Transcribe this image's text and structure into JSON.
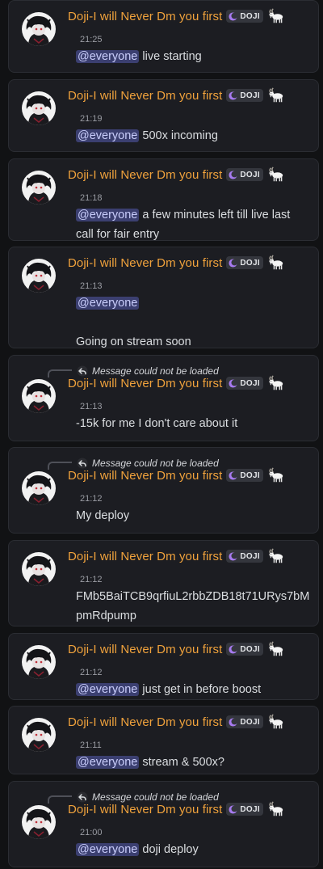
{
  "messages": [
    {
      "username": "Doji-I will Never Dm you first",
      "tag": "DOJI",
      "time": "21:25",
      "reply": null,
      "content": [
        {
          "mention": "@everyone",
          "text": " live starting"
        }
      ]
    },
    {
      "username": "Doji-I will Never Dm you first",
      "tag": "DOJI",
      "time": "21:19",
      "reply": null,
      "content": [
        {
          "mention": "@everyone",
          "text": " 500x incoming"
        }
      ]
    },
    {
      "username": "Doji-I will Never Dm you first",
      "tag": "DOJI",
      "time": "21:18",
      "reply": null,
      "content": [
        {
          "mention": "@everyone",
          "text": " a few minutes left till live last"
        },
        {
          "text": "call for fair entry"
        }
      ]
    },
    {
      "username": "Doji-I will Never Dm you first",
      "tag": "DOJI",
      "time": "21:13",
      "reply": null,
      "content": [
        {
          "mention": "@everyone"
        },
        {
          "text": ""
        },
        {
          "text": "Going on stream soon"
        }
      ]
    },
    {
      "username": "Doji-I will Never Dm you first",
      "tag": "DOJI",
      "time": "21:13",
      "reply": "Message could not be loaded",
      "content": [
        {
          "text": "-15k for me I don't care about it"
        }
      ]
    },
    {
      "username": "Doji-I will Never Dm you first",
      "tag": "DOJI",
      "time": "21:12",
      "reply": "Message could not be loaded",
      "content": [
        {
          "text": "My deploy"
        }
      ]
    },
    {
      "username": "Doji-I will Never Dm you first",
      "tag": "DOJI",
      "time": "21:12",
      "reply": null,
      "content": [
        {
          "text": "FMb5BaiTCB9qrfiuL2rbbZDB18t71URys7bM"
        },
        {
          "text": "pmRdpump"
        }
      ]
    },
    {
      "username": "Doji-I will Never Dm you first",
      "tag": "DOJI",
      "time": "21:12",
      "reply": null,
      "content": [
        {
          "mention": "@everyone",
          "text": " just get in before boost"
        }
      ]
    },
    {
      "username": "Doji-I will Never Dm you first",
      "tag": "DOJI",
      "time": "21:11",
      "reply": null,
      "content": [
        {
          "mention": "@everyone",
          "text": " stream & 500x?"
        }
      ]
    },
    {
      "username": "Doji-I will Never Dm you first",
      "tag": "DOJI",
      "time": "21:00",
      "reply": "Message could not be loaded",
      "content": [
        {
          "mention": "@everyone",
          "text": " doji deploy"
        }
      ]
    }
  ],
  "icons": {
    "avatar": "avatar-image",
    "tag": "moon-icon",
    "emoji": "goat-icon",
    "reply": "reply-arrow-icon"
  },
  "colors": {
    "background": "#111214",
    "card": "#1c1d22",
    "username": "#f0a23c",
    "mention_bg": "#3b3f70",
    "mention_text": "#c9cdfb",
    "tag_icon": "#a77bf0"
  }
}
